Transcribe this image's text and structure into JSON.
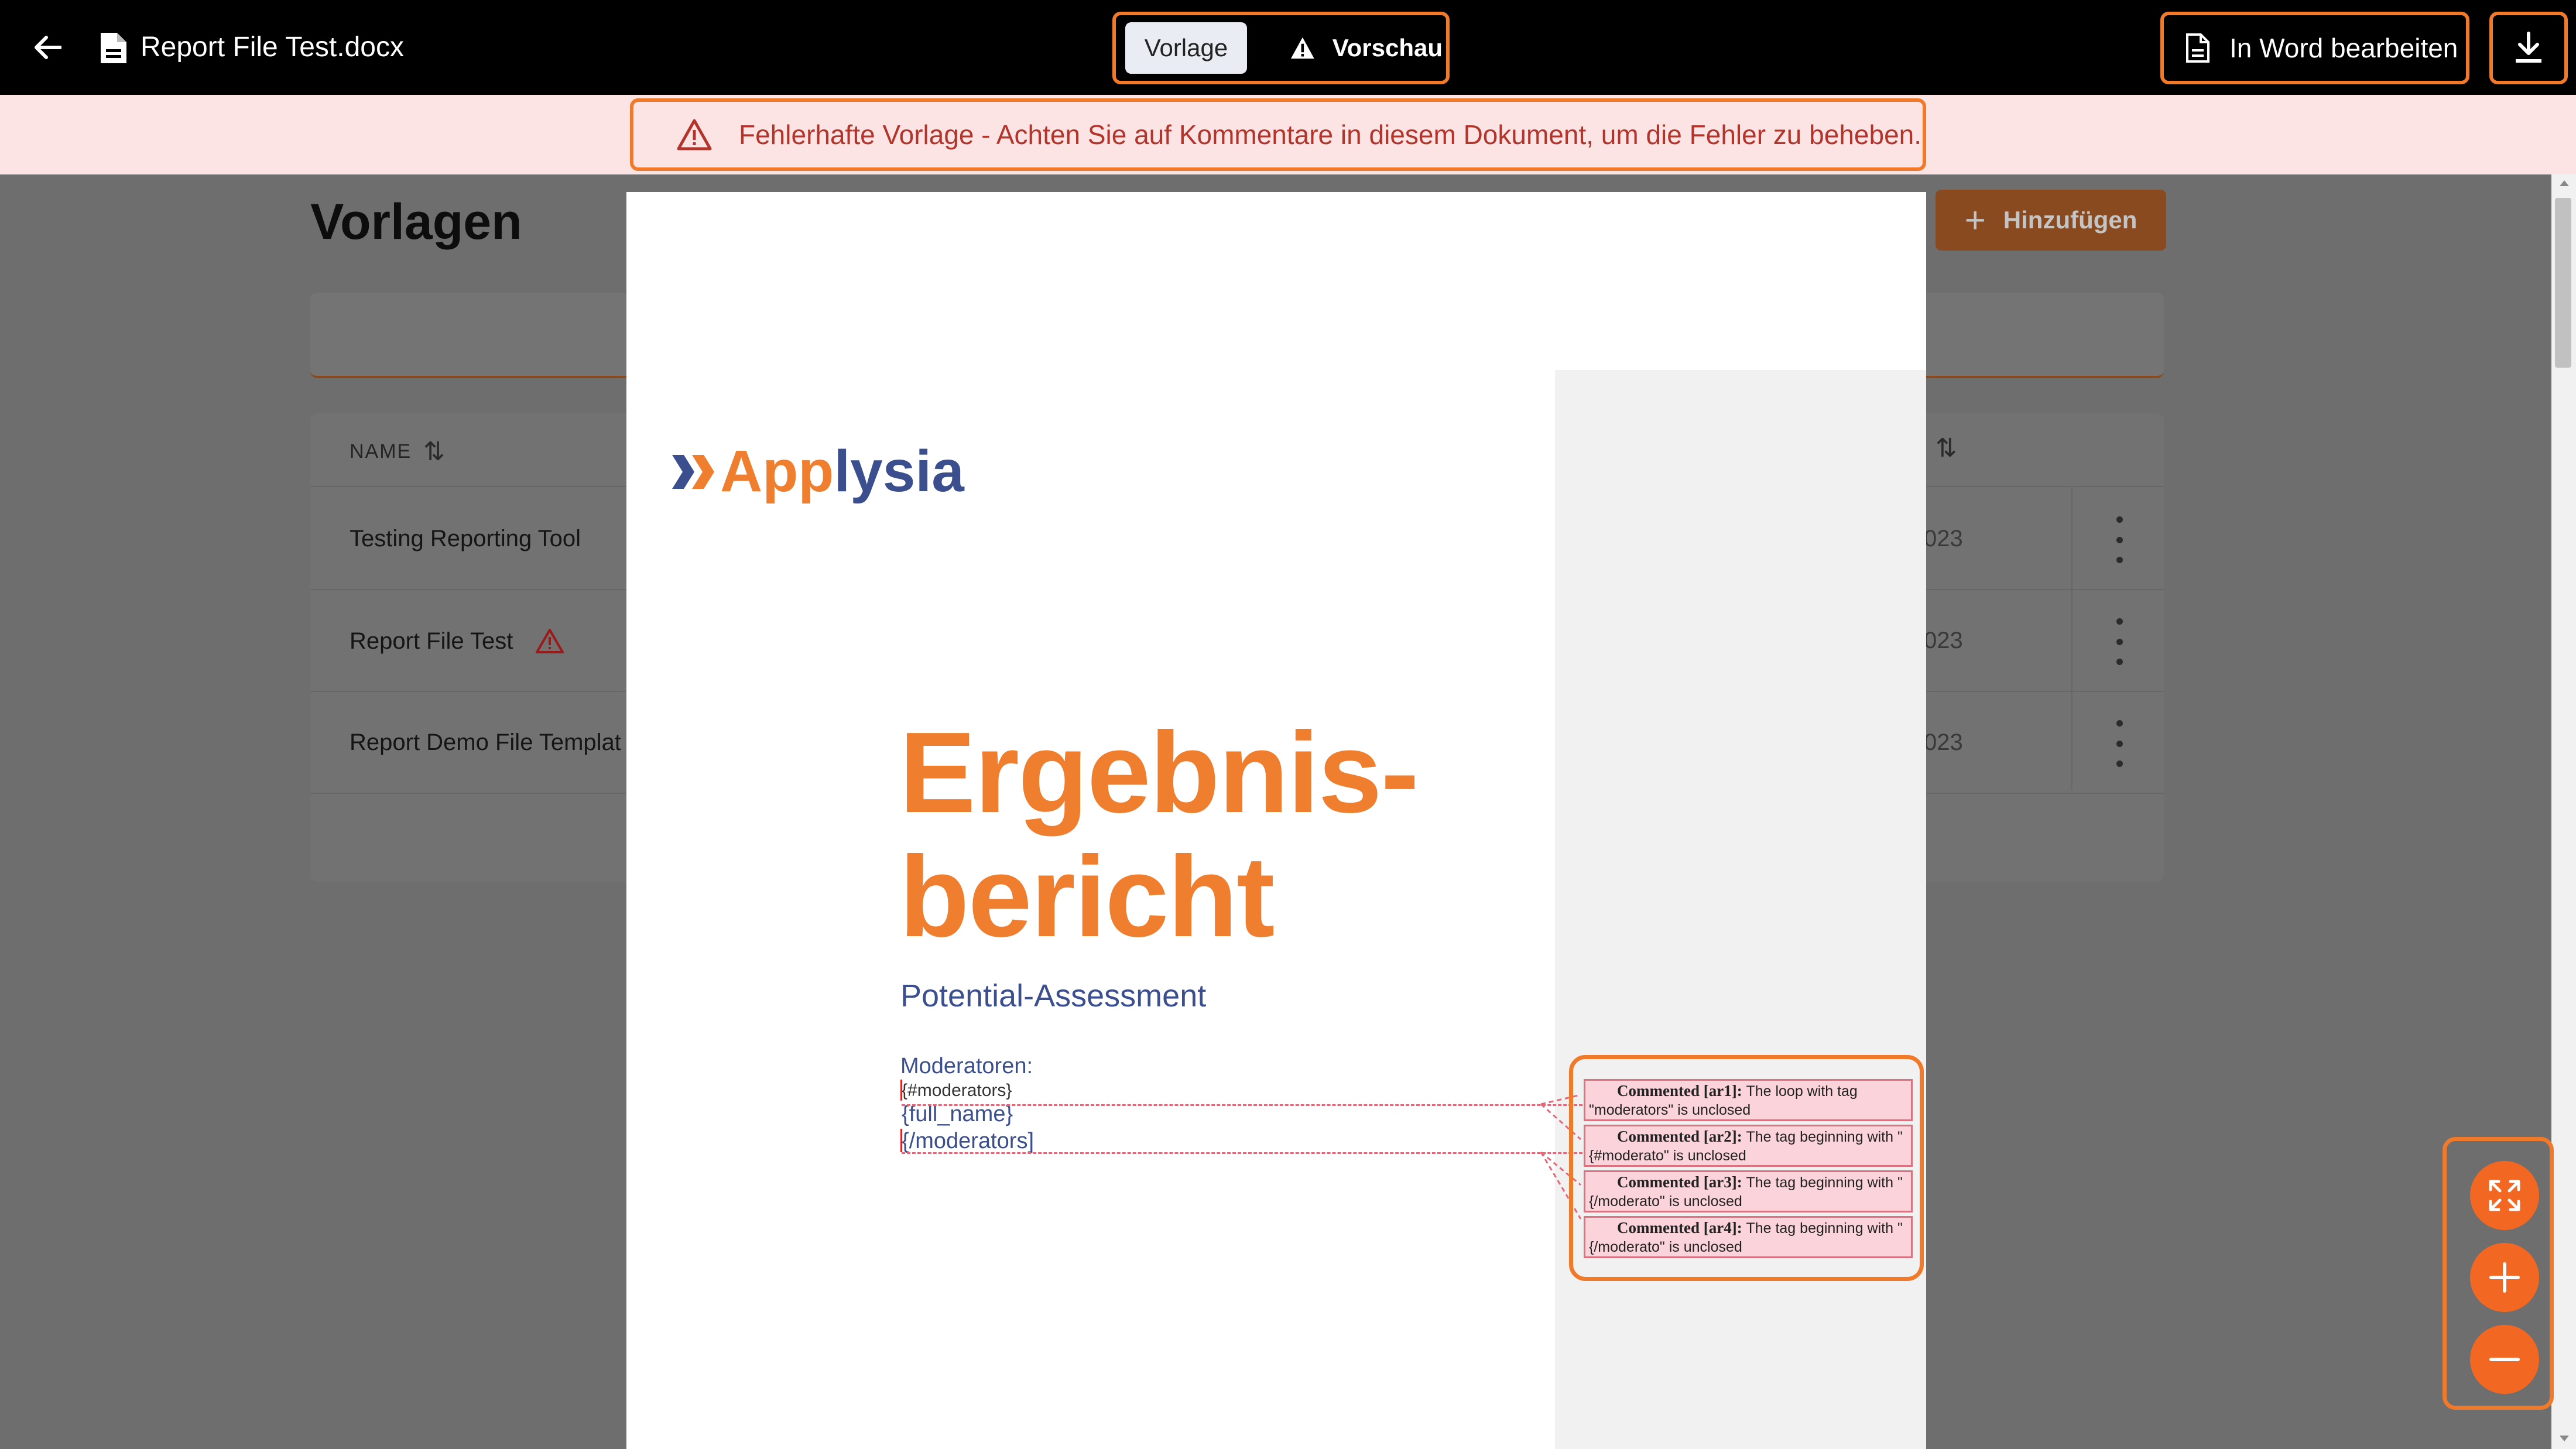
{
  "header": {
    "file_name": "Report File Test.docx",
    "tabs": [
      {
        "label": "Vorlage",
        "active": true
      },
      {
        "label": "Vorschau",
        "active": false,
        "icon": "warning-icon"
      }
    ],
    "edit_in_word_label": "In Word bearbeiten",
    "icons": [
      "arrow-left-icon",
      "document-icon",
      "file-icon",
      "download-icon"
    ]
  },
  "banner": {
    "message": "Fehlerhafte Vorlage - Achten Sie auf Kommentare in diesem Dokument, um die Fehler zu beheben.",
    "icon": "warning-icon"
  },
  "background": {
    "title": "Vorlagen",
    "add_label": "Hinzufügen",
    "table": {
      "name_header": "NAME",
      "rows": [
        {
          "name": "Testing Reporting Tool",
          "date": "023",
          "warning": false
        },
        {
          "name": "Report File Test",
          "date": "023",
          "warning": true
        },
        {
          "name": "Report Demo File Templat",
          "date": "023",
          "warning": false
        }
      ]
    }
  },
  "document": {
    "logo_part1": "App",
    "logo_part2": "lysia",
    "heading_line1": "Ergebnis-",
    "heading_line2": "bericht",
    "subtitle": "Potential-Assessment",
    "moderators_label": "Moderatoren:",
    "tag_open": "{#moderators}",
    "tag_field": "{full_name}",
    "tag_close": "{/moderators]",
    "comments": [
      {
        "head": "Commented [ar1]:",
        "body": "The loop with tag \"moderators\" is unclosed"
      },
      {
        "head": "Commented [ar2]:",
        "body": "The tag beginning with \"{#moderato\" is unclosed"
      },
      {
        "head": "Commented [ar3]:",
        "body": "The tag beginning with \"{/moderato\" is unclosed"
      },
      {
        "head": "Commented [ar4]:",
        "body": "The tag beginning with \"{/moderato\" is unclosed"
      }
    ]
  },
  "zoom_controls": [
    "fullscreen-icon",
    "zoom-in-icon",
    "zoom-out-icon"
  ],
  "colors": {
    "accent": "#f26722",
    "highlight_border": "#f07a2a",
    "logo_orange": "#ef7f2f",
    "logo_blue": "#3b4f8f",
    "error_text": "#b2342a",
    "error_background": "#fde4e4"
  }
}
